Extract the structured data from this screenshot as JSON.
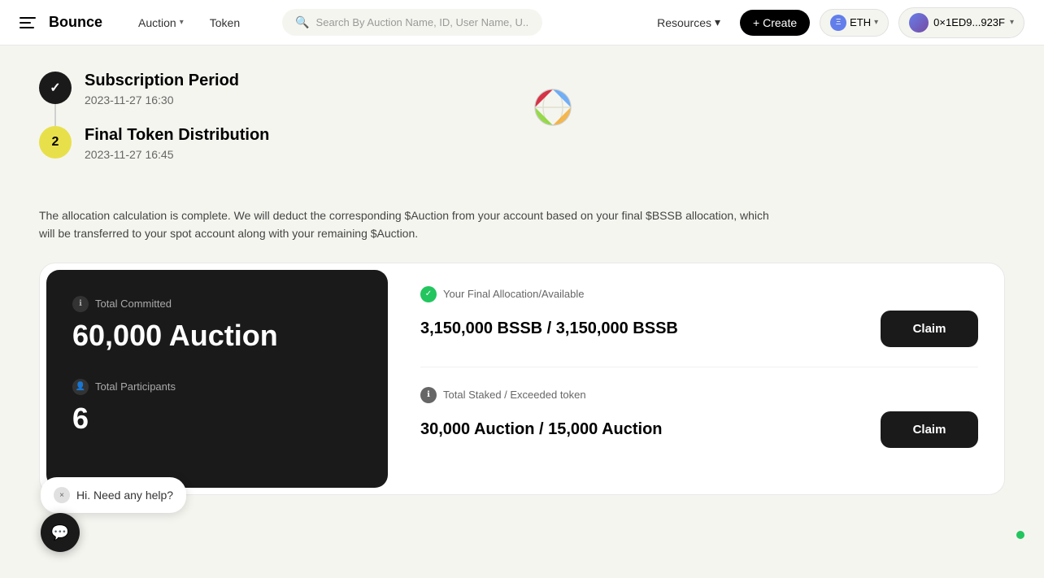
{
  "nav": {
    "logo_text": "Bounce",
    "auction_label": "Auction",
    "token_label": "Token",
    "search_placeholder": "Search By Auction Name, ID, User Name, U...",
    "resources_label": "Resources",
    "create_label": "+ Create",
    "eth_network": "ETH",
    "wallet_address": "0×1ED9...923F"
  },
  "timeline": {
    "step1": {
      "marker": "✓",
      "title": "Subscription Period",
      "date": "2023-11-27 16:30"
    },
    "step2": {
      "marker": "2",
      "title": "Final Token Distribution",
      "date": "2023-11-27 16:45"
    }
  },
  "allocation_description": "The allocation calculation is complete. We will deduct the corresponding $Auction from your account based on your final $BSSB allocation, which will be transferred to your spot account along with your remaining $Auction.",
  "card": {
    "total_committed_label": "Total Committed",
    "total_committed_value": "60,000 Auction",
    "total_participants_label": "Total Participants",
    "total_participants_value": "6",
    "final_allocation_label": "Your Final Allocation/Available",
    "final_allocation_value": "3,150,000 BSSB / 3,150,000 BSSB",
    "claim_label_1": "Claim",
    "total_staked_label": "Total Staked / Exceeded token",
    "total_staked_value": "30,000 Auction / 15,000 Auction",
    "claim_label_2": "Claim"
  },
  "chat": {
    "message": "Hi. Need any help?",
    "close": "×"
  }
}
